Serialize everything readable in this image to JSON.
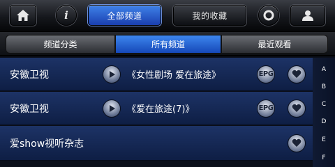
{
  "topbar": {
    "home_icon": "home-icon",
    "info_icon": "info-icon",
    "info_glyph": "i",
    "all_channels": "全部频道",
    "my_favorites": "我的收藏",
    "search_icon": "search-icon",
    "user_icon": "user-icon"
  },
  "tabs": [
    {
      "label": "频道分类"
    },
    {
      "label": "所有频道",
      "active": true
    },
    {
      "label": "最近观看"
    }
  ],
  "channels": [
    {
      "name": "安徽卫视",
      "program": "《女性剧场 爱在旅途》",
      "epg": "EPG",
      "has_play": true
    },
    {
      "name": "安徽卫视",
      "program": "《爱在旅途(7)》",
      "epg": "EPG",
      "has_play": true
    },
    {
      "name": "爱show视听杂志",
      "program": "",
      "epg": "",
      "has_play": false
    }
  ],
  "alpha_index": [
    "A",
    "B",
    "C",
    "D",
    "E",
    "F"
  ],
  "colors": {
    "accent_blue": "#2a6ae0",
    "row_blue": "#1a2f60"
  }
}
